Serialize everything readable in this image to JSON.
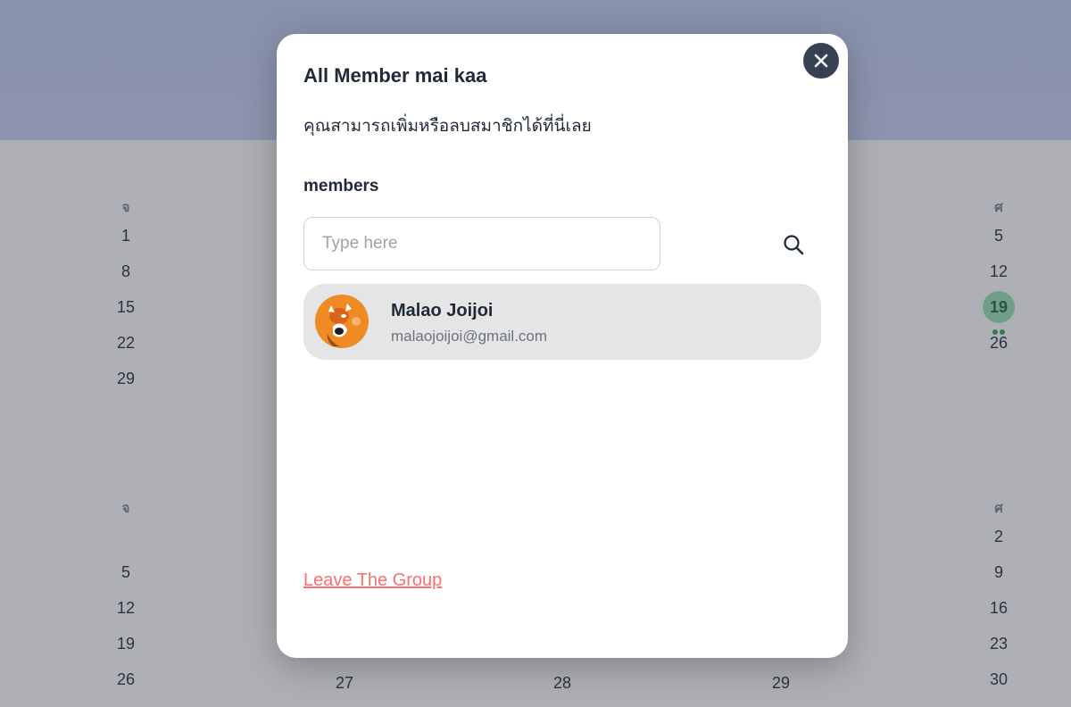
{
  "calendar": {
    "weekday_first": "จ",
    "weekday_last": "ศ",
    "month1": {
      "col1": [
        "1",
        "8",
        "15",
        "22",
        "29"
      ],
      "col5": [
        "5",
        "12",
        "19",
        "26"
      ]
    },
    "month2": {
      "col1": [
        "5",
        "12",
        "19",
        "26"
      ],
      "col5": [
        "2",
        "9",
        "16",
        "23",
        "30"
      ],
      "col2_last": "27",
      "col3_last": "28",
      "col4_last": "29"
    },
    "today_highlight_color": "#8fe0ad"
  },
  "modal": {
    "title": "All Member mai kaa",
    "description": "คุณสามารถเพิ่มหรือลบสมาชิกได้ที่นี่เลย",
    "members_label": "members",
    "search": {
      "placeholder": "Type here",
      "value": ""
    },
    "members": [
      {
        "name": "Malao Joijoi",
        "email": "malaojoijoi@gmail.com",
        "avatar": "orange-cat-avatar"
      }
    ],
    "leave_label": "Leave The Group",
    "close_icon": "close-icon",
    "search_icon": "search-icon"
  },
  "colors": {
    "leave_link": "#f87171",
    "close_button": "#374151",
    "member_row_bg": "#e5e5e5"
  }
}
